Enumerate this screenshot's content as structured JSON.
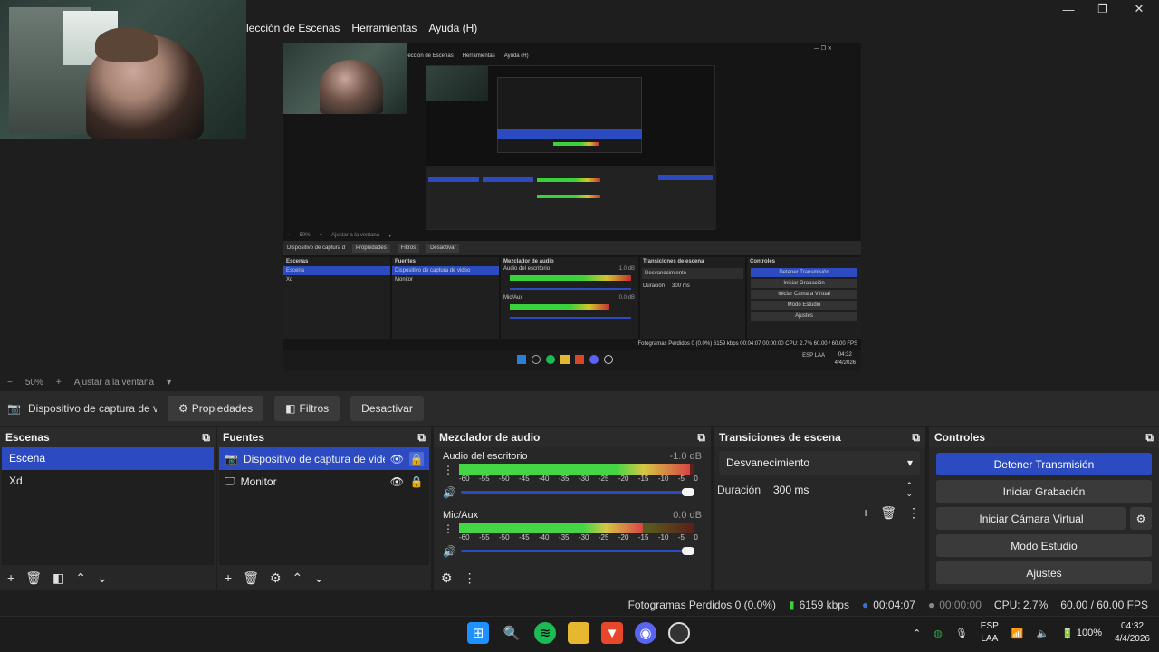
{
  "menubar": {
    "items": [
      "lección de Escenas",
      "Herramientas",
      "Ayuda (H)"
    ]
  },
  "window_controls": {
    "minimize": "—",
    "restore": "❐",
    "close": "✕"
  },
  "nested_preview": {
    "menu_items": [
      "lección de Escenas",
      "Herramientas",
      "Ayuda (H)"
    ],
    "context_source": "Dispositivo de captura d",
    "context_buttons": [
      "Propiedades",
      "Filtros",
      "Desactivar"
    ],
    "zoom_label": "50%",
    "fit_label": "Ajustar a la ventana",
    "dock_titles": [
      "Escenas",
      "Fuentes",
      "Mezclador de audio",
      "Transiciones de escena",
      "Controles"
    ],
    "scenes": [
      "Escena",
      "Xd"
    ],
    "sources": [
      "Dispositivo de captura de video",
      "Monitor"
    ],
    "mixer_channels": [
      {
        "name": "Audio del escritorio",
        "db": "-1.0 dB"
      },
      {
        "name": "Mic/Aux",
        "db": "0.0 dB"
      }
    ],
    "transition": "Desvanecimiento",
    "duration_label": "Duración",
    "duration": "300 ms",
    "controls": [
      "Detener Transmisión",
      "Iniciar Grabación",
      "Iniciar Cámara Virtual",
      "Modo Estudio",
      "Ajustes"
    ],
    "status": "Fotogramas Perdidos 0 (0.0%)  6159 kbps  00:04:07  00:00:00  CPU: 2.7%  60.00 / 60.00 FPS",
    "clock_time": "04:32",
    "clock_date": "4/4/2026",
    "lang": "ESP LAA"
  },
  "preview_toolbar": {
    "minus": "−",
    "zoom": "50%",
    "plus": "+",
    "fit": "Ajustar a la ventana"
  },
  "context_bar": {
    "source_name": "Dispositivo de captura de v",
    "properties_label": "Propiedades",
    "filters_label": "Filtros",
    "deactivate_label": "Desactivar"
  },
  "scenes_dock": {
    "title": "Escenas",
    "items": [
      {
        "label": "Escena",
        "selected": true
      },
      {
        "label": "Xd",
        "selected": false
      }
    ]
  },
  "sources_dock": {
    "title": "Fuentes",
    "items": [
      {
        "label": "Dispositivo de captura de video",
        "selected": true
      },
      {
        "label": "Monitor",
        "selected": false
      }
    ]
  },
  "mixer_dock": {
    "title": "Mezclador de audio",
    "ticks": [
      "-60",
      "-55",
      "-50",
      "-45",
      "-40",
      "-35",
      "-30",
      "-25",
      "-20",
      "-15",
      "-10",
      "-5",
      "0"
    ],
    "channels": [
      {
        "name": "Audio del escritorio",
        "db": "-1.0 dB",
        "level_fraction": 0.98,
        "volume_fraction": 1.0
      },
      {
        "name": "Mic/Aux",
        "db": "0.0 dB",
        "level_fraction": 0.78,
        "volume_fraction": 1.0
      }
    ]
  },
  "transitions_dock": {
    "title": "Transiciones de escena",
    "transition": "Desvanecimiento",
    "duration_label": "Duración",
    "duration_value": "300 ms"
  },
  "controls_dock": {
    "title": "Controles",
    "stop_stream": "Detener Transmisión",
    "start_recording": "Iniciar Grabación",
    "start_virtual_cam": "Iniciar Cámara Virtual",
    "studio_mode": "Modo Estudio",
    "settings": "Ajustes"
  },
  "status_bar": {
    "dropped_frames": "Fotogramas Perdidos 0 (0.0%)",
    "bitrate": "6159 kbps",
    "stream_time": "00:04:07",
    "rec_time": "00:00:00",
    "cpu": "CPU: 2.7%",
    "fps": "60.00 / 60.00 FPS"
  },
  "taskbar": {
    "lang_top": "ESP",
    "lang_bottom": "LAA",
    "battery": "100%",
    "time": "04:32",
    "date": "4/4/2026"
  },
  "colors": {
    "accent": "#2c4bc1",
    "panel": "#272727",
    "background": "#1e1e1e"
  }
}
